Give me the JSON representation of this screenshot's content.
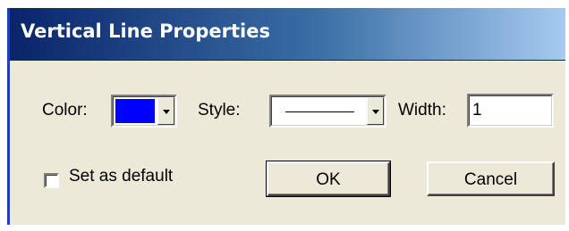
{
  "dialog": {
    "title": "Vertical Line Properties"
  },
  "color": {
    "label": "Color:",
    "value": "#0000ff",
    "icon": "chevron-down-icon"
  },
  "style": {
    "label": "Style:",
    "value": "solid",
    "icon": "chevron-down-icon"
  },
  "width": {
    "label": "Width:",
    "value": "1"
  },
  "default_checkbox": {
    "label": "Set as default",
    "checked": false
  },
  "buttons": {
    "ok": "OK",
    "cancel": "Cancel"
  },
  "colors": {
    "title_start": "#0a246a",
    "title_end": "#a6caf0",
    "dialog_bg": "#ece9d8",
    "title_text": "#ffffff"
  }
}
